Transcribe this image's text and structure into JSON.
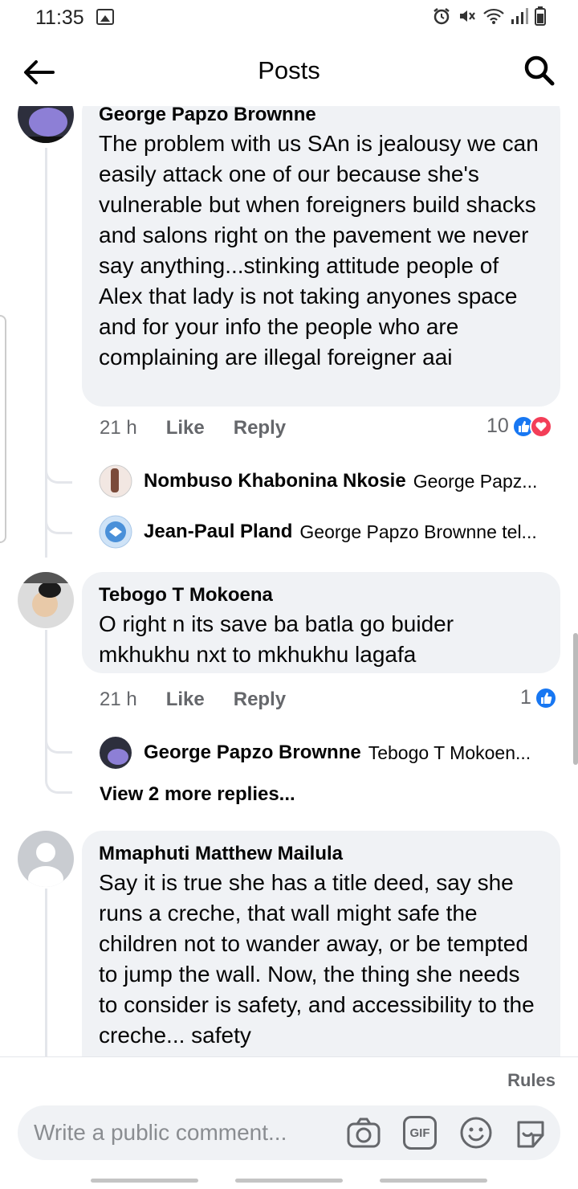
{
  "status_bar": {
    "time": "11:35"
  },
  "header": {
    "title": "Posts"
  },
  "comments": [
    {
      "author": "George Papzo Brownne",
      "text": "The problem with us SAn is jealousy we can easily attack one of our because she's vulnerable but when foreigners build shacks and salons right on the pavement we never say anything...stinking attitude people of Alex that lady is not taking anyones space and for your info the people who are complaining are illegal foreigner aai",
      "time": "21 h",
      "like_label": "Like",
      "reply_label": "Reply",
      "reaction_count": "10",
      "replies": [
        {
          "author": "Nombuso Khabonina Nkosie",
          "snippet": "George Papz..."
        },
        {
          "author": "Jean-Paul Pland",
          "snippet": "George Papzo Brownne tel..."
        }
      ]
    },
    {
      "author": "Tebogo T Mokoena",
      "text": "O right n its save ba batla go buider mkhukhu nxt to mkhukhu lagafa",
      "time": "21 h",
      "like_label": "Like",
      "reply_label": "Reply",
      "reaction_count": "1",
      "replies": [
        {
          "author": "George Papzo Brownne",
          "snippet": "Tebogo T Mokoen..."
        }
      ],
      "more_replies": "View 2 more replies..."
    },
    {
      "author": "Mmaphuti Matthew Mailula",
      "text": "Say it is true she has a title deed, say she runs a creche, that wall might safe the children not to wander away, or be tempted to jump the wall. Now, the thing she needs to consider is safety, and accessibility to the creche... safety"
    }
  ],
  "composer": {
    "rules_label": "Rules",
    "placeholder": "Write a public comment...",
    "gif_label": "GIF"
  },
  "colors": {
    "like_blue": "#1877f2",
    "love_red": "#f33e58",
    "bubble_bg": "#f0f2f5",
    "meta_gray": "#65676b"
  }
}
